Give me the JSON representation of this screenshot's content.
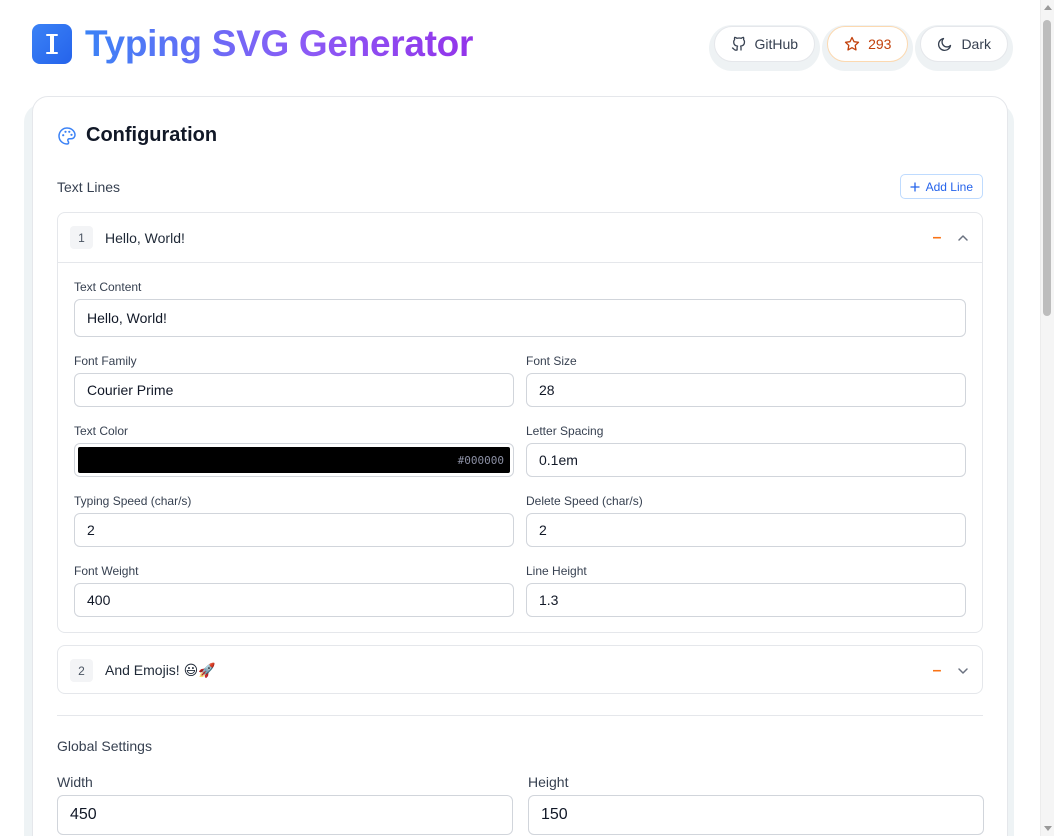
{
  "header": {
    "title": "Typing SVG Generator",
    "buttons": {
      "github": "GitHub",
      "stars": "293",
      "theme": "Dark"
    }
  },
  "config": {
    "title": "Configuration",
    "text_lines_label": "Text Lines",
    "add_line_label": "Add Line",
    "lines": [
      {
        "number": "1",
        "name": "Hello, World!",
        "expanded": true,
        "fields": {
          "text_content_label": "Text Content",
          "text_content": "Hello, World!",
          "font_family_label": "Font Family",
          "font_family": "Courier Prime",
          "font_size_label": "Font Size",
          "font_size": "28",
          "text_color_label": "Text Color",
          "text_color": "#000000",
          "letter_spacing_label": "Letter Spacing",
          "letter_spacing": "0.1em",
          "typing_speed_label": "Typing Speed (char/s)",
          "typing_speed": "2",
          "delete_speed_label": "Delete Speed (char/s)",
          "delete_speed": "2",
          "font_weight_label": "Font Weight",
          "font_weight": "400",
          "line_height_label": "Line Height",
          "line_height": "1.3"
        }
      },
      {
        "number": "2",
        "name": "And Emojis! 😃🚀",
        "expanded": false
      }
    ],
    "global": {
      "label": "Global Settings",
      "width_label": "Width",
      "width": "450",
      "height_label": "Height",
      "height": "150"
    }
  },
  "colors": {
    "accent": "#2563eb",
    "remove": "#f97316",
    "title_gradient_start": "#3b82f6",
    "title_gradient_end": "#9333ea"
  }
}
